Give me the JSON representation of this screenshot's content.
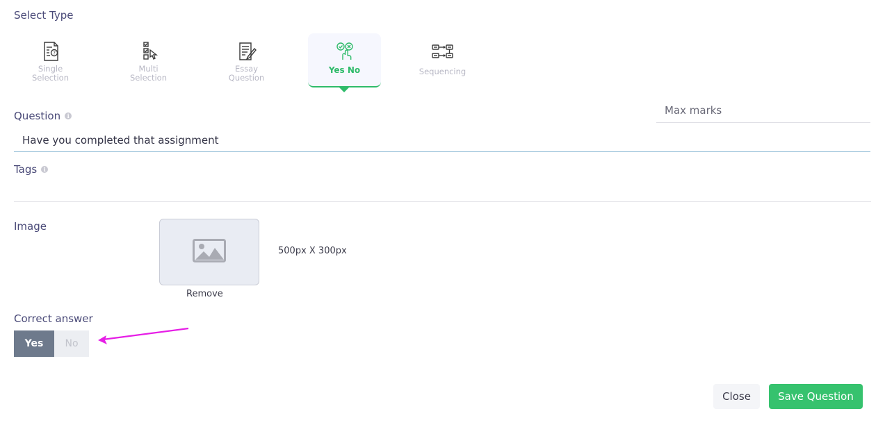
{
  "header": {
    "select_type_label": "Select Type"
  },
  "question_types": [
    {
      "label_line1": "Single",
      "label_line2": "Selection",
      "icon": "single-selection-icon",
      "active": false
    },
    {
      "label_line1": "Multi",
      "label_line2": "Selection",
      "icon": "multi-selection-icon",
      "active": false
    },
    {
      "label_line1": "Essay",
      "label_line2": "Question",
      "icon": "essay-question-icon",
      "active": false
    },
    {
      "label_line1": "Yes No",
      "label_line2": "",
      "icon": "yes-no-icon",
      "active": true
    },
    {
      "label_line1": "Sequencing",
      "label_line2": "",
      "icon": "sequencing-icon",
      "active": false
    }
  ],
  "question": {
    "label": "Question",
    "value": "Have you completed that assignment"
  },
  "max_marks": {
    "placeholder": "Max marks",
    "value": ""
  },
  "tags": {
    "label": "Tags",
    "value": ""
  },
  "image": {
    "label": "Image",
    "size_hint": "500px X 300px",
    "remove_label": "Remove",
    "icon": "image-placeholder-icon"
  },
  "correct_answer": {
    "label": "Correct answer",
    "yes_label": "Yes",
    "no_label": "No",
    "selected": "Yes"
  },
  "footer": {
    "close_label": "Close",
    "save_label": "Save Question"
  },
  "colors": {
    "accent_green": "#36c26e",
    "active_tab_green": "#2fbb6a",
    "selected_yes": "#6e7a8c",
    "annotation_arrow": "#e61ee6"
  }
}
